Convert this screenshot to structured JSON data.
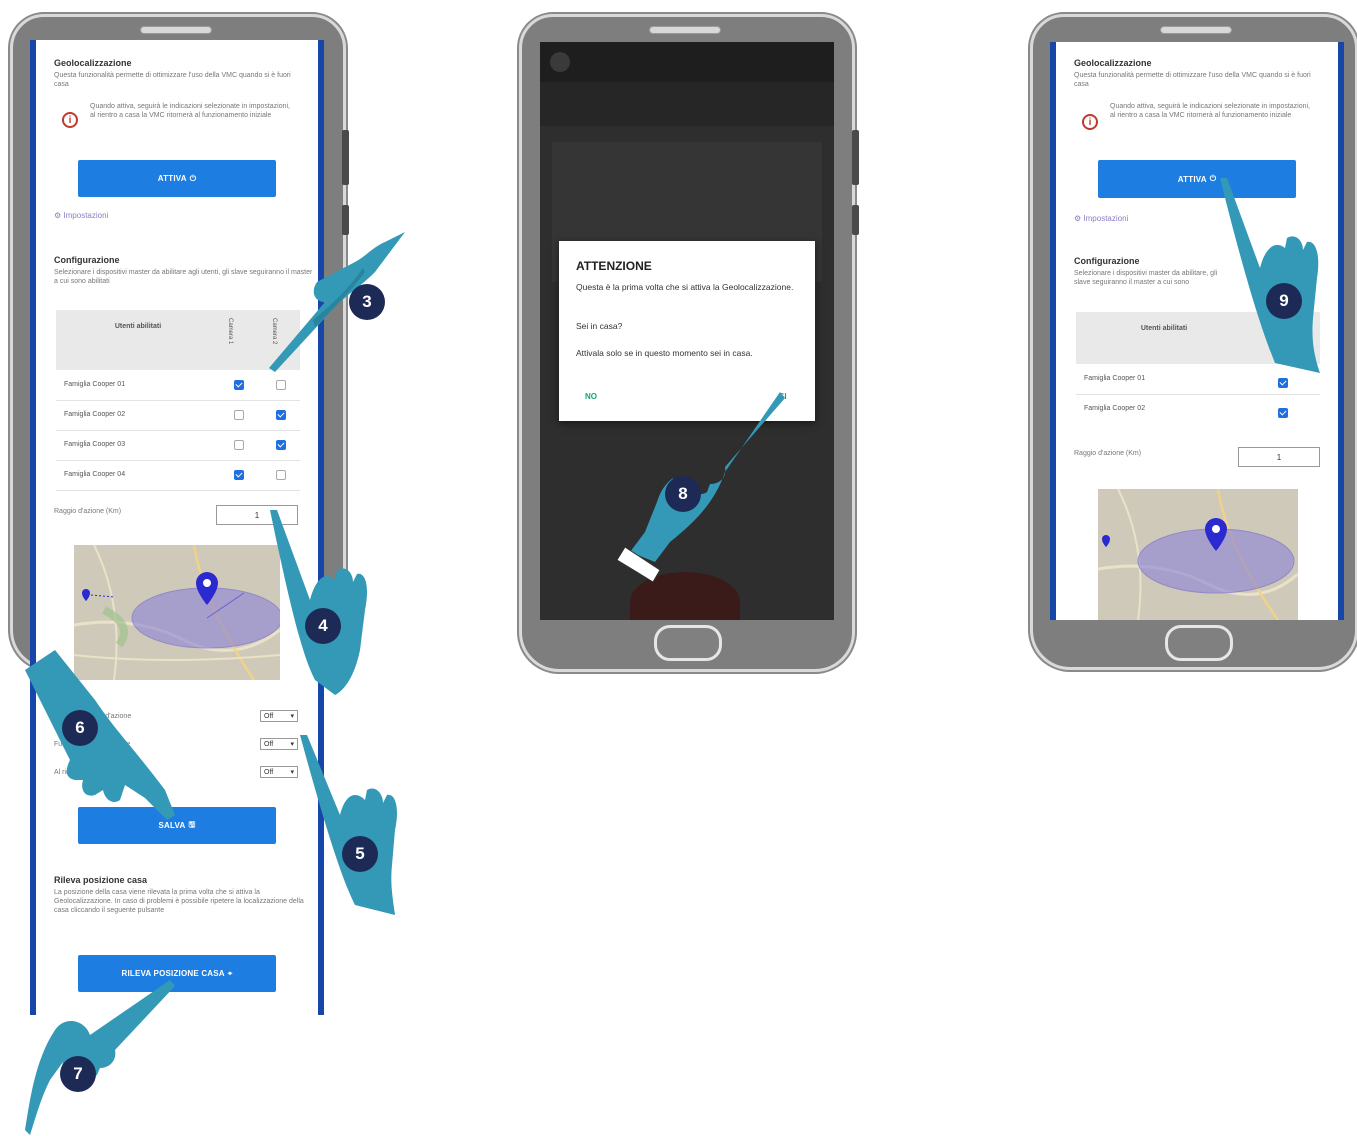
{
  "screen1": {
    "geo_title": "Geolocalizzazione",
    "geo_desc": "Questa funzionalità permette di ottimizzare l'uso della VMC quando si è fuori casa",
    "info_text": "Quando attiva, seguirà le indicazioni selezionate in impostazioni, al rientro a casa la VMC ritornerà al funzionamento iniziale",
    "activate_label": "ATTIVA",
    "settings_link": "Impostazioni",
    "config_title": "Configurazione",
    "config_desc": "Selezionare i dispositivi master da abilitare agli utenti, gli slave seguiranno il master a cui sono abilitati",
    "table": {
      "header_users": "Utenti abilitati",
      "col1": "Camera 1",
      "col2": "Camera 2",
      "rows": [
        {
          "name": "Famiglia Cooper 01",
          "c1": true,
          "c2": false
        },
        {
          "name": "Famiglia Cooper 02",
          "c1": false,
          "c2": true
        },
        {
          "name": "Famiglia Cooper 03",
          "c1": false,
          "c2": true
        },
        {
          "name": "Famiglia Cooper 04",
          "c1": true,
          "c2": false
        }
      ]
    },
    "radius_label": "Raggio d'azione (Km)",
    "radius_value": "1",
    "option_rows": [
      {
        "label": "Entro del raggio d'azione",
        "value": "Off"
      },
      {
        "label": "Fuori dal raggio d'azione",
        "value": "Off"
      },
      {
        "label": "Al rientro nel raggio d'azione",
        "value": "Off"
      }
    ],
    "save_label": "SALVA",
    "home_title": "Rileva posizione casa",
    "home_desc": "La posizione della casa viene rilevata la prima volta che si attiva la Geolocalizzazione. In caso di problemi è possibile ripetere la localizzazione della casa cliccando il seguente pulsante",
    "detect_label": "RILEVA POSIZIONE CASA"
  },
  "screen2": {
    "dialog_title": "ATTENZIONE",
    "dialog_line1": "Questa è la prima volta che si attiva la Geolocalizzazione.",
    "dialog_line2": "Sei in casa?",
    "dialog_line3": "Attivala solo se in questo momento sei in casa.",
    "no_label": "NO",
    "yes_label": "SI"
  },
  "screen3": {
    "geo_title": "Geolocalizzazione",
    "geo_desc": "Questa funzionalità permette di ottimizzare l'uso della VMC quando si è fuori casa",
    "info_text": "Quando attiva, seguirà le indicazioni selezionate in impostazioni, al rientro a casa la VMC ritornerà al funzionamento iniziale",
    "activate_label": "ATTIVA",
    "settings_link": "Impostazioni",
    "config_title": "Configurazione",
    "config_desc": "Selezionare i dispositivi master da abilitare, gli slave seguiranno il master a cui sono",
    "header_users": "Utenti abilitati",
    "rows": [
      "Famiglia Cooper 01",
      "Famiglia Cooper 02"
    ],
    "radius_label": "Raggio d'azione (Km)",
    "radius_value": "1"
  },
  "steps": {
    "s3": "3",
    "s4": "4",
    "s5": "5",
    "s6": "6",
    "s7": "7",
    "s8": "8",
    "s9": "9"
  },
  "colors": {
    "accent_blue": "#1e7de1",
    "edge_blue": "#1546a8",
    "hand_teal": "#2f93ad",
    "badge_navy": "#1d2a56",
    "map_pin": "#2a2ad0"
  }
}
